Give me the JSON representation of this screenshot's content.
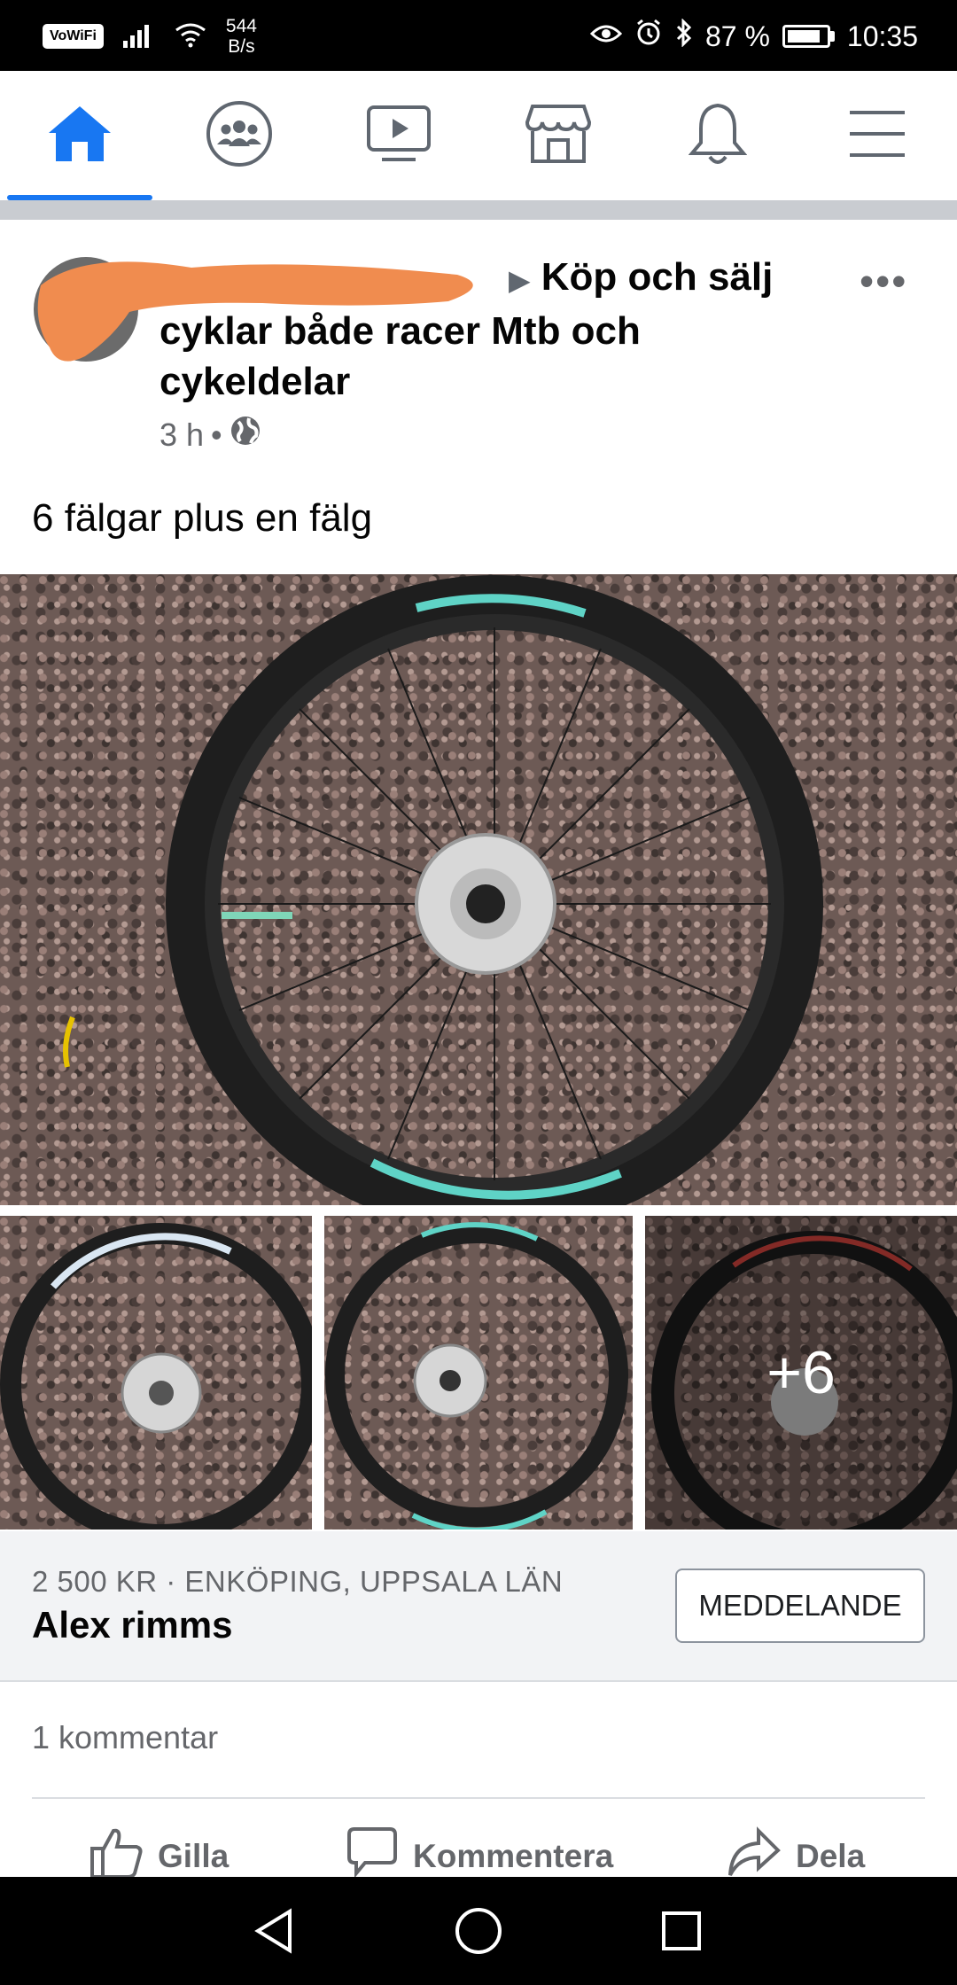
{
  "status_bar": {
    "vowifi": "VoWiFi",
    "net_speed_value": "544",
    "net_speed_unit": "B/s",
    "battery_percent": "87 %",
    "battery_level": 0.87,
    "time": "10:35",
    "icons": [
      "signal-icon",
      "wifi-icon",
      "eye-icon",
      "alarm-icon",
      "bluetooth-icon",
      "battery-icon"
    ]
  },
  "nav": {
    "active": "home",
    "items": [
      "home-icon",
      "groups-icon",
      "watch-icon",
      "marketplace-icon",
      "notifications-icon",
      "menu-icon"
    ],
    "accent_color": "#1877f2"
  },
  "post": {
    "group_name": "Köp och sälj cyklar både racer Mtb och cykeldelar",
    "time": "3 h",
    "separator": "•",
    "more": "•••",
    "text": "6 fälgar  plus en fälg",
    "more_photos": "+6"
  },
  "listing": {
    "price_location": "2 500 KR · ENKÖPING, UPPSALA LÄN",
    "seller": "Alex rimms",
    "message_button": "MEDDELANDE"
  },
  "engagement": {
    "comments": "1 kommentar",
    "like": "Gilla",
    "comment": "Kommentera",
    "share": "Dela"
  }
}
